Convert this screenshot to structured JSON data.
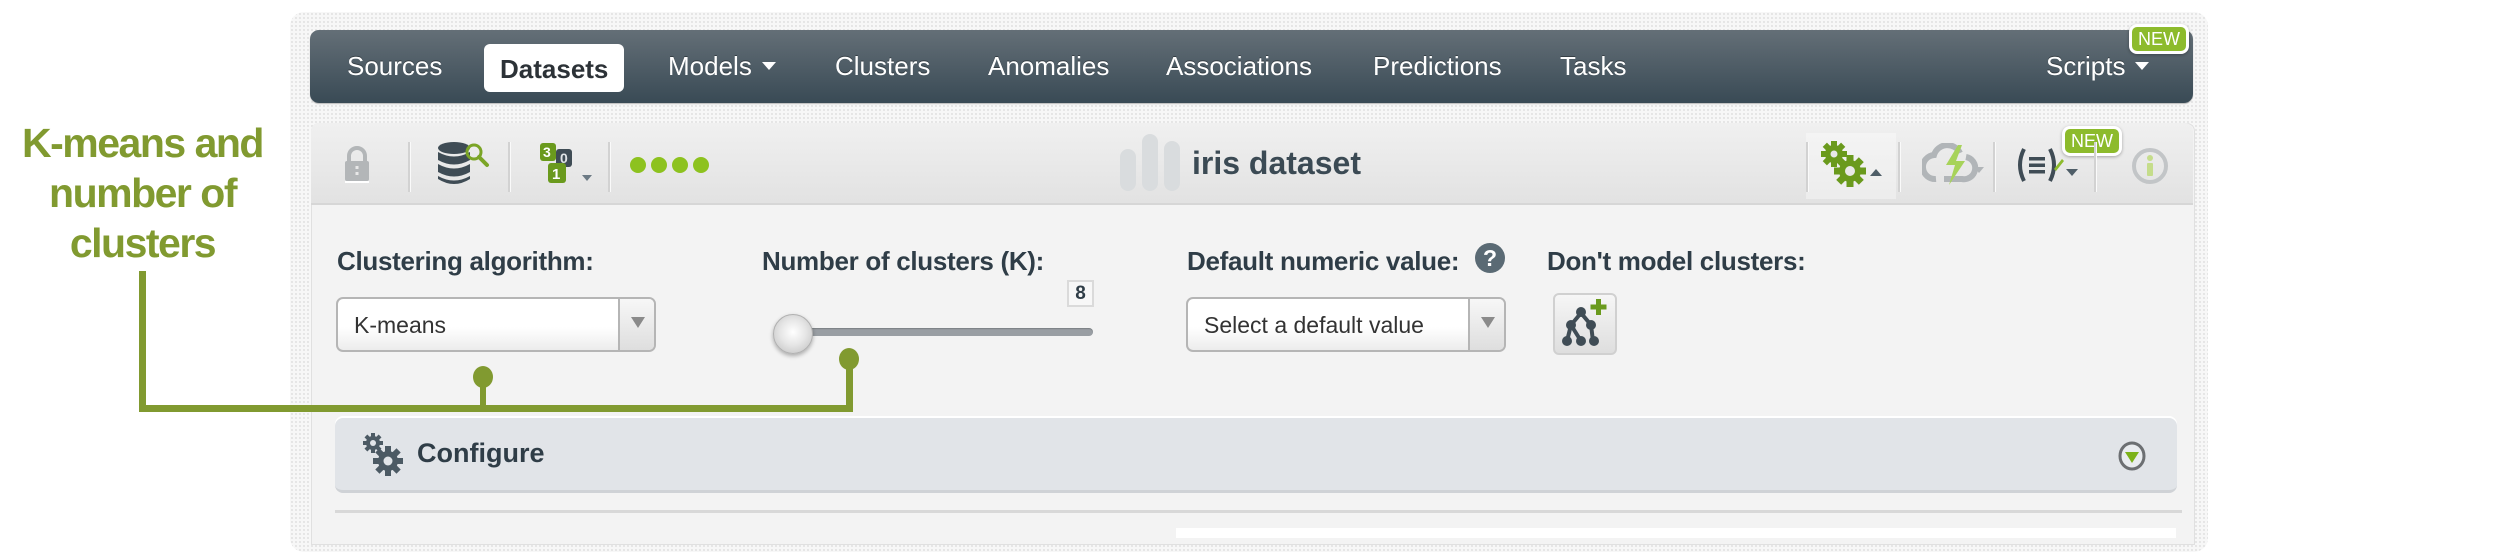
{
  "annotation": {
    "lines": [
      "K-means and",
      "number of",
      "clusters"
    ],
    "color": "#819a30"
  },
  "nav": {
    "items": [
      {
        "label": "Sources",
        "active": false
      },
      {
        "label": "Datasets",
        "active": true
      },
      {
        "label": "Models",
        "dropdown": true
      },
      {
        "label": "Clusters"
      },
      {
        "label": "Anomalies"
      },
      {
        "label": "Associations"
      },
      {
        "label": "Predictions"
      },
      {
        "label": "Tasks"
      }
    ],
    "right_item": {
      "label": "Scripts",
      "dropdown": true,
      "badge": "NEW"
    }
  },
  "toolbar": {
    "left_icons": [
      "lock-icon",
      "dataset-search-icon",
      "field-types-icon",
      "status-dots-icon"
    ],
    "title": "iris dataset",
    "right_icons": [
      "configure-gears-icon",
      "flash-cloud-icon",
      "code-script-icon",
      "info-icon"
    ],
    "script_badge": "NEW"
  },
  "form": {
    "algorithm": {
      "label": "Clustering algorithm:",
      "value": "K-means"
    },
    "k": {
      "label": "Number of clusters (K):",
      "value": "8"
    },
    "default_numeric": {
      "label": "Default numeric value:",
      "help": "?",
      "placeholder": "Select a default value"
    },
    "dont_model": {
      "label": "Don't model clusters:"
    }
  },
  "configure": {
    "label": "Configure"
  },
  "colors": {
    "accent_green": "#8dbb2c",
    "nav_dark": "#394a55",
    "text_dark": "#2f3d47"
  }
}
